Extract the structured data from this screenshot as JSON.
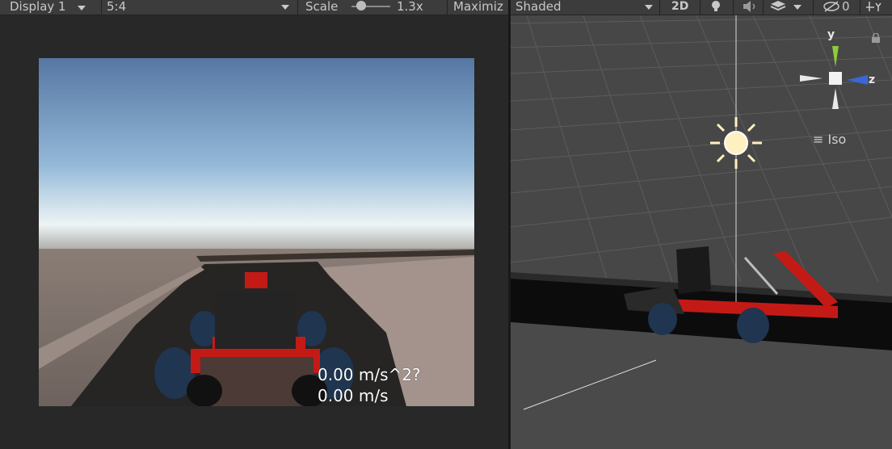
{
  "game_toolbar": {
    "display": "Display 1",
    "aspect": "5:4",
    "scale_label": "Scale",
    "scale_value": "1.3x",
    "maximize": "Maximiz"
  },
  "scene_toolbar": {
    "shading": "Shaded",
    "mode_2d": "2D",
    "hidden_count": "0"
  },
  "hud": {
    "acceleration": "0.00 m/s^2?",
    "speed": "0.00 m/s"
  },
  "gizmo": {
    "y": "y",
    "z": "z",
    "projection": "Iso"
  },
  "colors": {
    "kart_red": "#c41a16",
    "tire": "#1f3550",
    "gizmo_y": "#8ccc3a",
    "gizmo_z": "#3a66d8"
  }
}
